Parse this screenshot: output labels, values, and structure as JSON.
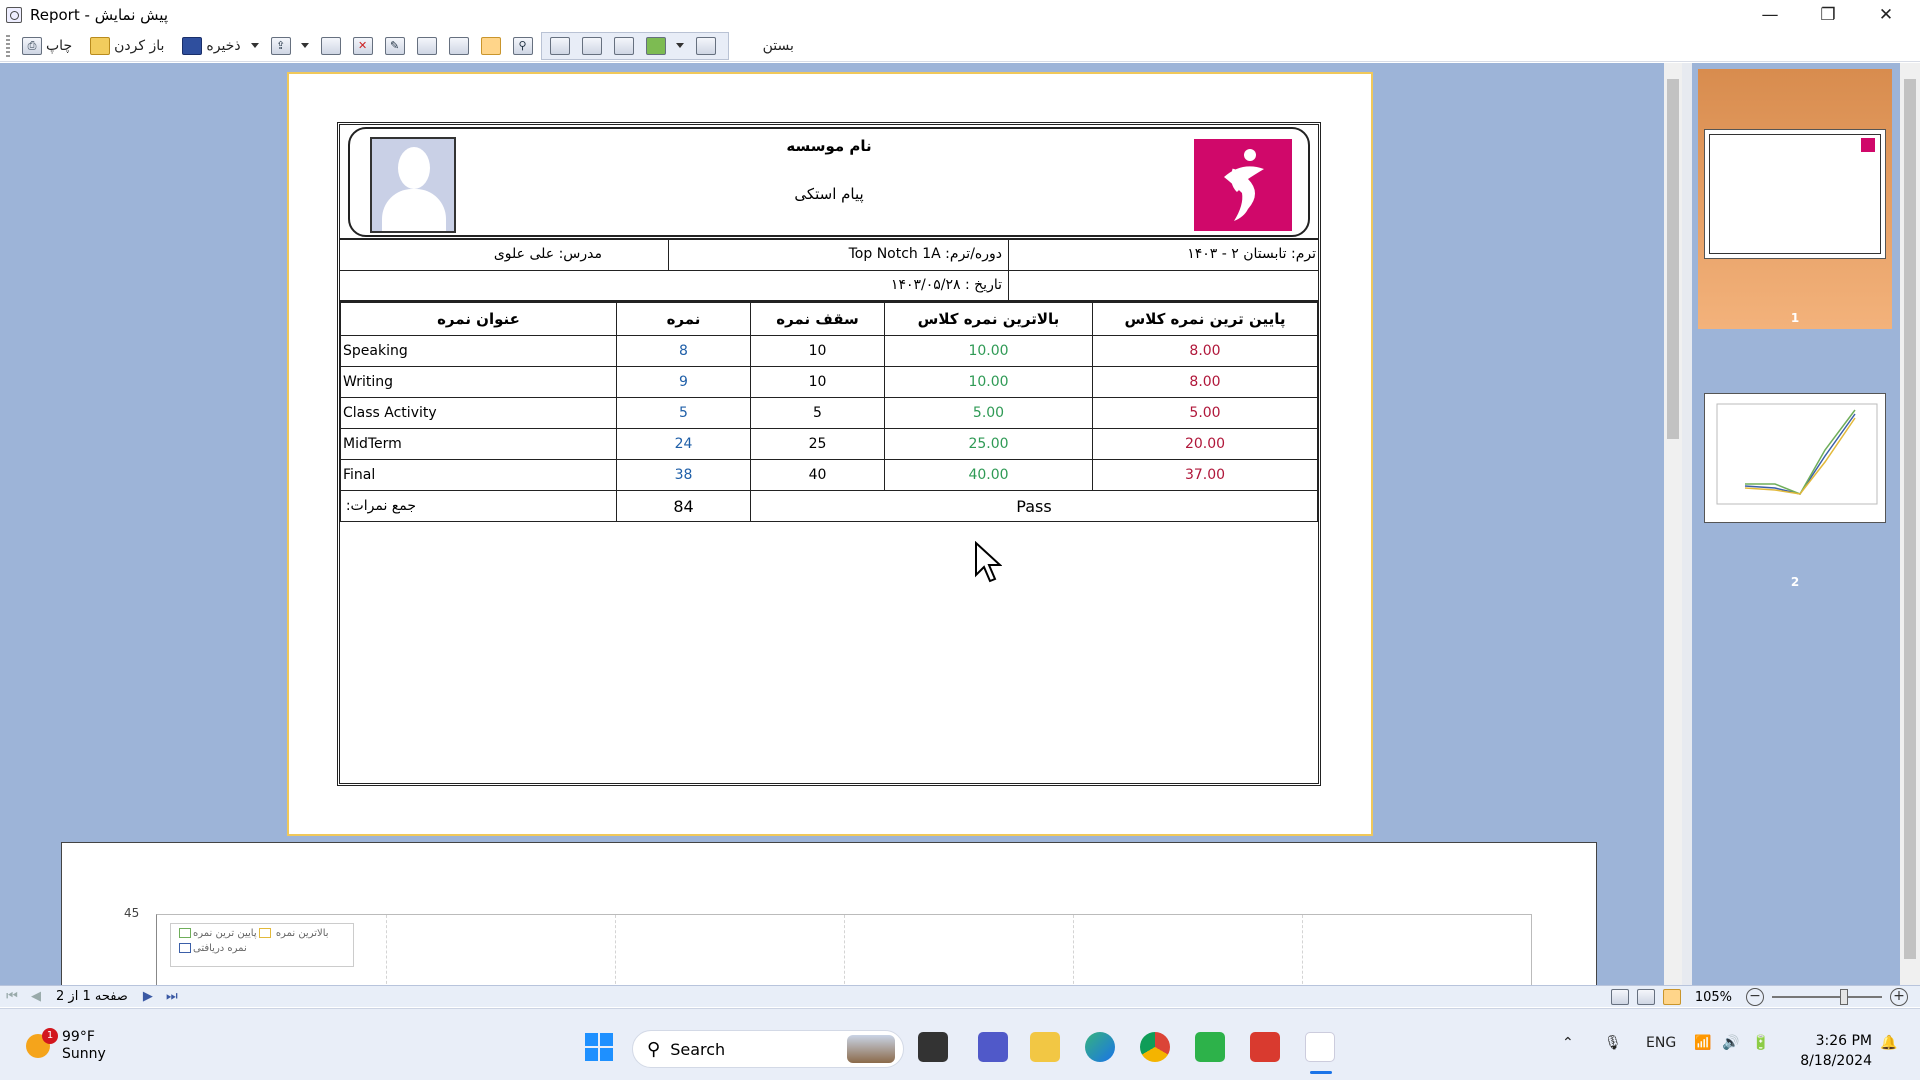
{
  "window": {
    "title": "Report - پیش نمایش",
    "minimize": "—",
    "maximize": "❐",
    "close": "✕"
  },
  "toolbar": {
    "print_label": "چاپ",
    "open_label": "باز کردن",
    "save_label": "ذخیره",
    "close_label": "بستن"
  },
  "report": {
    "institute_name": "نام موسسه",
    "institute_subtitle": "پیام استکی",
    "teacher": "مدرس: علی علوی",
    "course": "دوره/ترم: Top Notch 1A",
    "term": "ترم: تابستان ۲ - ۱۴۰۳",
    "date": "تاریخ : ۱۴۰۳/۰۵/۲۸",
    "columns": {
      "title": "عنوان نمره",
      "score": "نمره",
      "max": "سقف نمره",
      "highest": "بالاترین نمره کلاس",
      "lowest": "پایین ترین نمره کلاس"
    },
    "rows": [
      {
        "title": "Speaking",
        "score": "8",
        "max": "10",
        "highest": "10.00",
        "lowest": "8.00"
      },
      {
        "title": "Writing",
        "score": "9",
        "max": "10",
        "highest": "10.00",
        "lowest": "8.00"
      },
      {
        "title": "Class Activity",
        "score": "5",
        "max": "5",
        "highest": "5.00",
        "lowest": "5.00"
      },
      {
        "title": "MidTerm",
        "score": "24",
        "max": "25",
        "highest": "25.00",
        "lowest": "20.00"
      },
      {
        "title": "Final",
        "score": "38",
        "max": "40",
        "highest": "40.00",
        "lowest": "37.00"
      }
    ],
    "total_label": "جمع نمرات:",
    "total_value": "84",
    "result": "Pass"
  },
  "chart_data": {
    "type": "line",
    "yticks": [
      "45"
    ],
    "legend": [
      "پایین ترین نمره",
      "بالاترین نمره",
      "نمره دریافتی"
    ],
    "colors": {
      "lowest": "#e2b93b",
      "highest": "#6fae5a",
      "score": "#3b5fa8"
    }
  },
  "thumbnails": {
    "page1_label": "1",
    "page2_label": "2"
  },
  "statusbar": {
    "page_text": "صفحه 1 از 2",
    "zoom": "105%"
  },
  "taskbar": {
    "temperature": "99°F",
    "condition": "Sunny",
    "weather_badge": "1",
    "search_placeholder": "Search",
    "language": "ENG",
    "time": "3:26 PM",
    "date": "8/18/2024"
  }
}
